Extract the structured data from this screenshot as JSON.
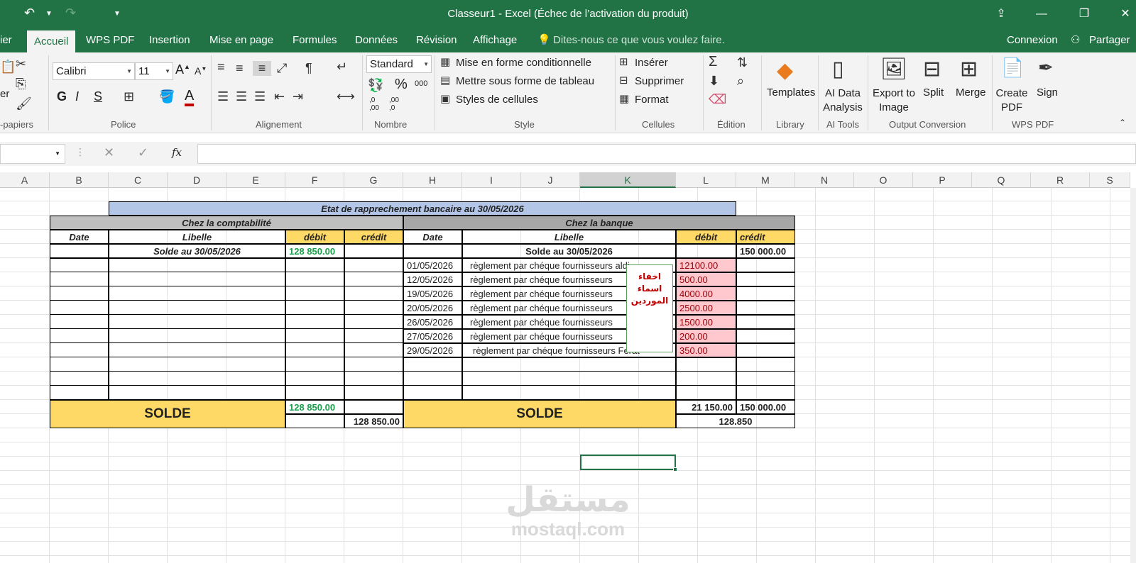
{
  "window": {
    "title": "Classeur1 - Excel (Échec de l’activation du produit)",
    "undo_icon": "undo-icon",
    "redo_icon": "redo-icon"
  },
  "tabs": [
    "ier",
    "Accueil",
    "WPS PDF",
    "Insertion",
    "Mise en page",
    "Formules",
    "Données",
    "Révision",
    "Affichage"
  ],
  "tell_me": "Dites-nous ce que vous voulez faire.",
  "account": {
    "signin": "Connexion",
    "share": "Partager"
  },
  "ribbon": {
    "clipboard_partial": "er",
    "font_name": "Calibri",
    "font_size": "11",
    "number_format": "Standard",
    "bold": "G",
    "italic": "I",
    "underline": "S",
    "percent": "%",
    "thousands": "000",
    "dec_inc": ",0 ,00",
    "dec_dec": ",00 ,0",
    "style_items": [
      "Mise en forme conditionnelle",
      "Mettre sous forme de tableau",
      "Styles de cellules"
    ],
    "cells_items": [
      "Insérer",
      "Supprimer",
      "Format"
    ],
    "big_buttons": [
      "Templates",
      "AI Data Analysis",
      "Export to Image",
      "Split",
      "Merge",
      "Create PDF",
      "Sign"
    ],
    "groups": [
      "-papiers",
      "Police",
      "Alignement",
      "Nombre",
      "Style",
      "Cellules",
      "Édition",
      "Library",
      "AI Tools",
      "Output Conversion",
      "WPS PDF"
    ]
  },
  "formula_bar": {
    "fx": "fx",
    "value": ""
  },
  "columns": [
    "A",
    "B",
    "C",
    "D",
    "E",
    "F",
    "G",
    "H",
    "I",
    "J",
    "K",
    "L",
    "M",
    "N",
    "O",
    "P",
    "Q",
    "R",
    "S"
  ],
  "sheet": {
    "main_title": "Etat de rapprechement bancaire au 30/05/2026",
    "left_header": "Chez la comptabilité",
    "right_header": "Chez la banque",
    "col_date": "Date",
    "col_libelle": "Libelle",
    "col_debit": "débit",
    "col_credit": "crédit",
    "left_solde_label": "Solde au  30/05/2026",
    "left_solde_debit": "128 850.00",
    "right_solde_label": "Solde au 30/05/2026",
    "right_solde_credit": "150 000.00",
    "bank_rows": [
      {
        "date": "01/05/2026",
        "libelle": "règlement par chéque fournisseurs aldi",
        "debit": "12100.00"
      },
      {
        "date": "12/05/2026",
        "libelle": "règlement par chéque fournisseurs",
        "debit": "500.00"
      },
      {
        "date": "19/05/2026",
        "libelle": "règlement par chéque fournisseurs",
        "debit": "4000.00"
      },
      {
        "date": "20/05/2026",
        "libelle": "règlement par chéque fournisseurs",
        "debit": "2500.00"
      },
      {
        "date": "26/05/2026",
        "libelle": "règlement par chéque fournisseurs",
        "debit": "1500.00"
      },
      {
        "date": "27/05/2026",
        "libelle": "règlement par chéque fournisseurs",
        "debit": "200.00"
      },
      {
        "date": "29/05/2026",
        "libelle": "règlement par chéque fournisseurs Ferat",
        "debit": "350.00"
      }
    ],
    "solde_label": "SOLDE",
    "left_total_debit": "128 850.00",
    "left_total_credit": "128 850.00",
    "right_total_debit": "21 150.00",
    "right_total_credit": "150 000.00",
    "right_total_balance": "128.850",
    "note_lines": [
      "اخفاء",
      "اسماء",
      "الموردين"
    ]
  },
  "watermark": {
    "arabic": "مستقل",
    "latin": "mostaql.com"
  }
}
